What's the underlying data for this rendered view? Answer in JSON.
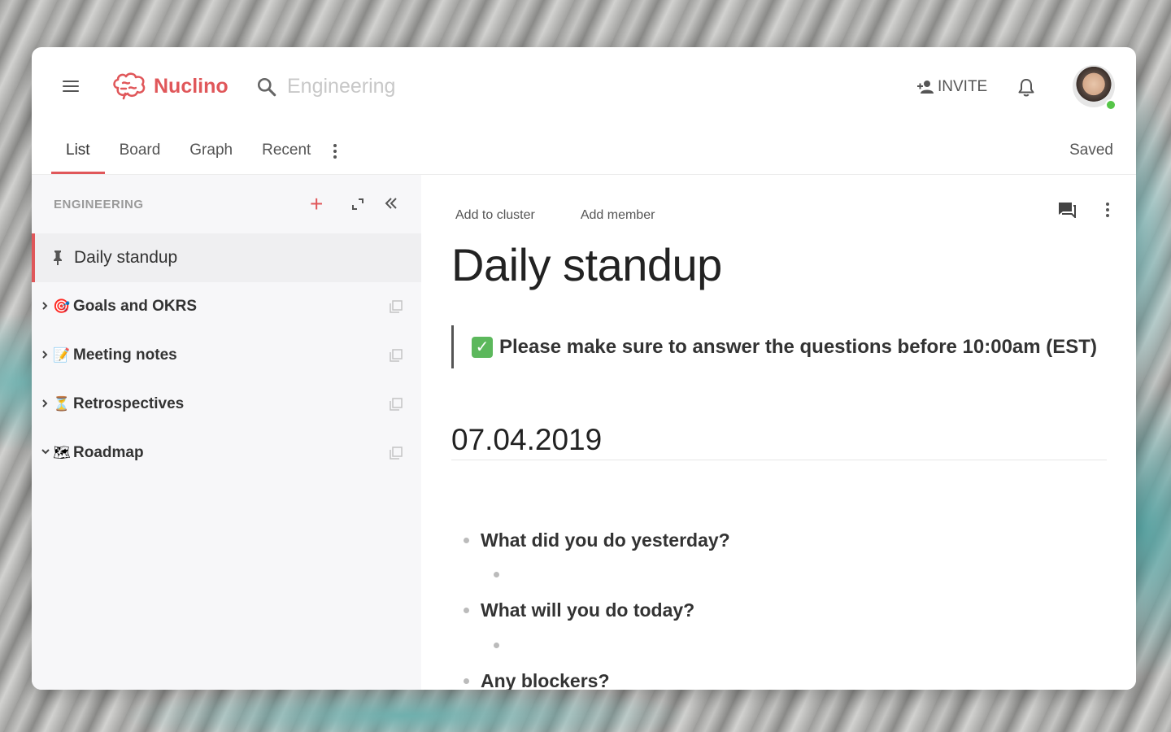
{
  "app": {
    "brand": "Nuclino",
    "accent_color": "#e0575a"
  },
  "header": {
    "search_placeholder": "Engineering",
    "invite_label": "INVITE",
    "status": "Saved"
  },
  "tabs": [
    {
      "label": "List",
      "active": true
    },
    {
      "label": "Board",
      "active": false
    },
    {
      "label": "Graph",
      "active": false
    },
    {
      "label": "Recent",
      "active": false
    }
  ],
  "sidebar": {
    "heading": "ENGINEERING",
    "pinned": {
      "label": "Daily standup",
      "icon": "pin-icon"
    },
    "items": [
      {
        "emoji": "🎯",
        "label": "Goals and OKRS",
        "chevron": "right"
      },
      {
        "emoji": "📝",
        "label": "Meeting notes",
        "chevron": "right"
      },
      {
        "emoji": "⏳",
        "label": "Retrospectives",
        "chevron": "right"
      },
      {
        "emoji": "🗺",
        "label": "Roadmap",
        "chevron": "down"
      }
    ]
  },
  "document": {
    "actions": {
      "add_cluster": "Add to cluster",
      "add_member": "Add member"
    },
    "title": "Daily standup",
    "callout": "Please make sure to answer the questions before 10:00am (EST)",
    "date_heading": "07.04.2019",
    "questions": [
      "What did you do yesterday?",
      "What will you do today?",
      "Any blockers?"
    ]
  }
}
